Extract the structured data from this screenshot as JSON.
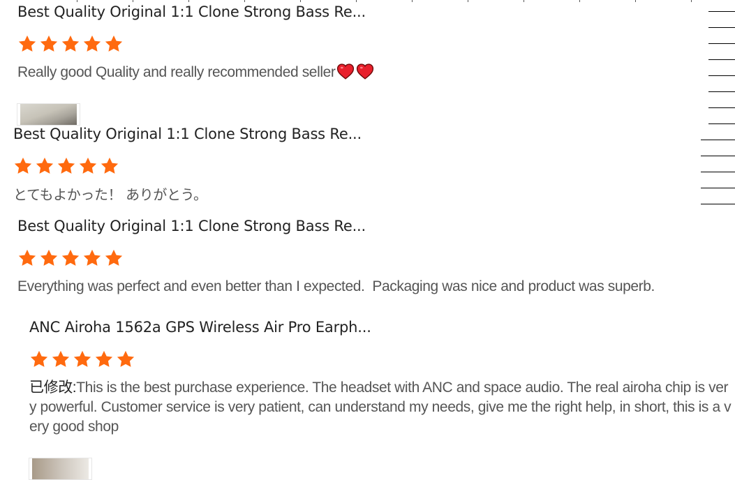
{
  "reviews": [
    {
      "product_title": "Best Quality Original 1:1 Clone Strong Bass Re...",
      "rating": 5,
      "text": "Really good Quality and really recommended seller",
      "emoji": [
        "heart-emoji",
        "heart-emoji"
      ]
    },
    {
      "product_title": "Best Quality Original 1:1 Clone Strong Bass Re...",
      "rating": 5,
      "text": "とてもよかった！ ありがとう。"
    },
    {
      "product_title": "Best Quality Original 1:1 Clone Strong Bass Re...",
      "rating": 5,
      "text": "Everything was perfect and even better than I expected.  Packaging was nice and product was superb."
    },
    {
      "product_title": "ANC Airoha 1562a GPS Wireless Air Pro Earph...",
      "rating": 5,
      "edited_prefix": "已修改:",
      "text": "This is the best purchase experience. The headset with ANC and space audio. The real airoha chip is very powerful. Customer service is very patient, can understand my needs, give me the right help, in short, this is a very good shop"
    }
  ],
  "colors": {
    "star": "#ff6a0f",
    "title": "#222222",
    "body_text": "#555555",
    "heart": "#e8202c"
  },
  "icons": {
    "star": "star-icon",
    "heart": "heart-emoji",
    "thumbnail": "review-photo-thumbnail"
  }
}
